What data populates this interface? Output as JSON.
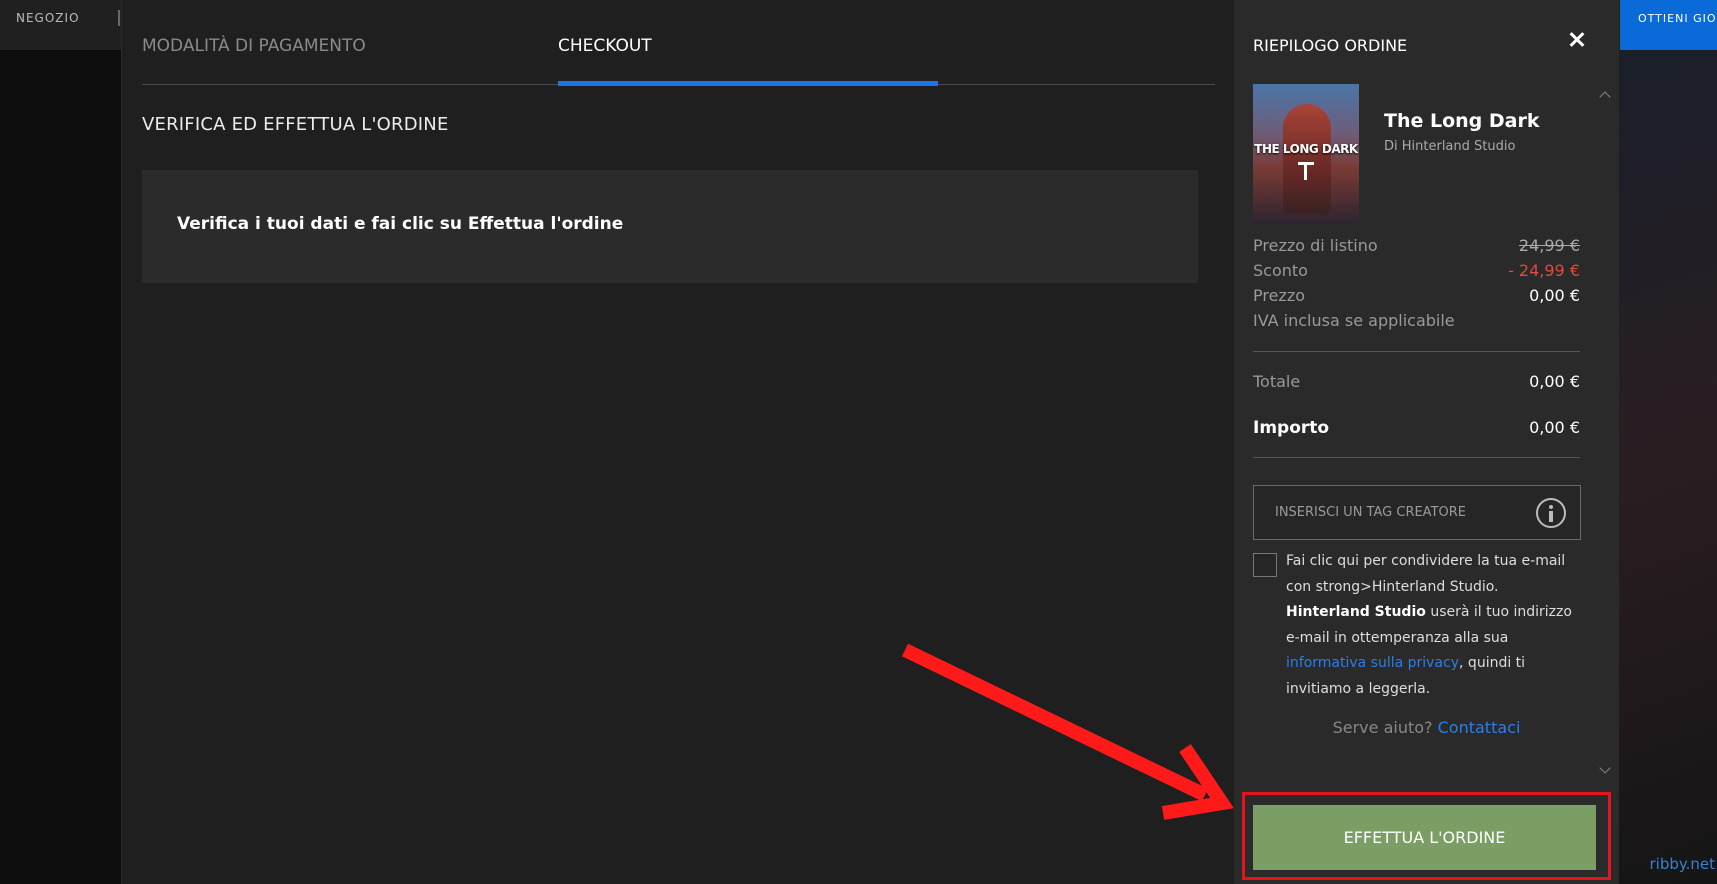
{
  "topbar": {
    "store_label": "NEGOZIO",
    "get_game_label": "OTTIENI GIOCO"
  },
  "checkout": {
    "tabs": [
      {
        "label": "MODALITÀ DI PAGAMENTO",
        "active": false
      },
      {
        "label": "CHECKOUT",
        "active": true
      }
    ],
    "section_title": "VERIFICA ED EFFETTUA L'ORDINE",
    "notice": "Verifica i tuoi dati e fai clic su Effettua l'ordine"
  },
  "summary": {
    "title": "RIEPILOGO ORDINE",
    "cover_title": "THE LONG DARK",
    "game_name": "The Long Dark",
    "developer": "Di Hinterland Studio",
    "list_price_label": "Prezzo di listino",
    "list_price": "24,99 €",
    "discount_label": "Sconto",
    "discount": "- 24,99 €",
    "price_label": "Prezzo",
    "price": "0,00 €",
    "vat_note": "IVA inclusa se applicabile",
    "total_label": "Totale",
    "total": "0,00 €",
    "amount_label": "Importo",
    "amount": "0,00 €",
    "creator_tag_placeholder": "INSERISCI UN TAG CREATORE",
    "consent": {
      "part1": "Fai clic qui per condividere la tua e-mail con strong>Hinterland Studio. ",
      "bold": "Hinterland Studio",
      "part2": " userà il tuo indirizzo e-mail in ottemperanza alla sua ",
      "link": "informativa sulla privacy",
      "part3": ", quindi ti invitiamo a leggerla."
    },
    "help_text": "Serve aiuto?",
    "help_link": "Contattaci",
    "order_button": "EFFETTUA L'ORDINE"
  },
  "colors": {
    "accent": "#1a73e8",
    "order_button": "#7a9e63",
    "discount": "#e04a3f",
    "highlight": "#e3141b"
  },
  "watermark": "ribby.net"
}
